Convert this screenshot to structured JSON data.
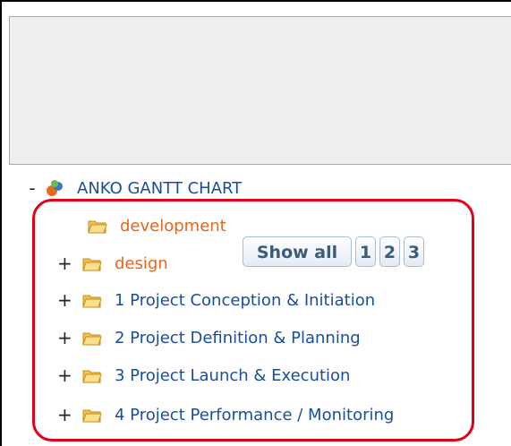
{
  "pager": {
    "show_all": "Show all",
    "pages": [
      "1",
      "2",
      "3"
    ]
  },
  "tree": {
    "root": {
      "toggle": "-",
      "label": "ANKO GANTT CHART"
    },
    "items": [
      {
        "toggle": "",
        "label": "development",
        "color": "#e8651a"
      },
      {
        "toggle": "+",
        "label": "design",
        "color": "#e8651a"
      },
      {
        "toggle": "+",
        "label": "1 Project Conception & Initiation",
        "color": "#1a4d9c"
      },
      {
        "toggle": "+",
        "label": "2 Project Definition & Planning",
        "color": "#1a4d9c"
      },
      {
        "toggle": "+",
        "label": "3 Project Launch & Execution",
        "color": "#1a4d9c"
      },
      {
        "toggle": "+",
        "label": "4 Project Performance / Monitoring",
        "color": "#1a4d9c"
      }
    ]
  },
  "colors": {
    "highlight": "#e3001b",
    "header_bg": "#efefef"
  }
}
